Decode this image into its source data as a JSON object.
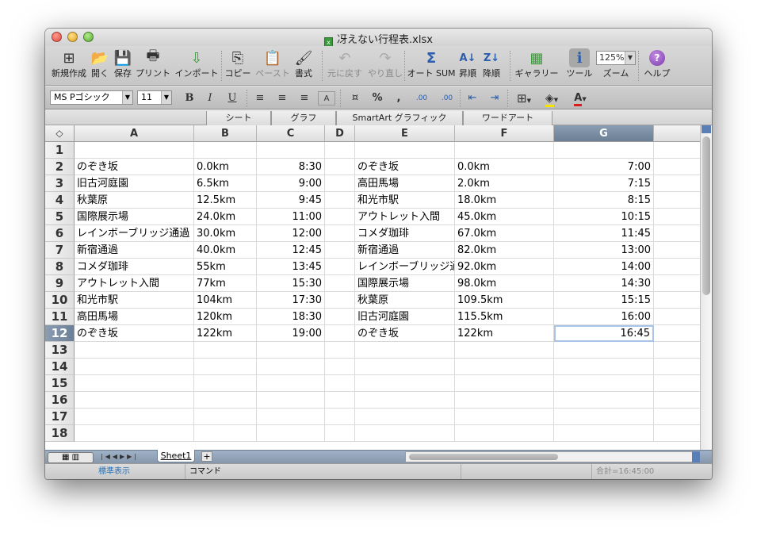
{
  "window": {
    "title": "冴えない行程表.xlsx"
  },
  "toolbar": {
    "items": [
      {
        "label": "新規作成",
        "icon": "new-workbook-icon",
        "glyph": "⊞",
        "enabled": true
      },
      {
        "label": "開く",
        "icon": "open-icon",
        "glyph": "📂",
        "enabled": true
      },
      {
        "label": "保存",
        "icon": "save-icon",
        "glyph": "💾",
        "enabled": true
      },
      {
        "label": "プリント",
        "icon": "print-icon",
        "glyph": "🖶",
        "enabled": true
      },
      {
        "label": "インポート",
        "icon": "import-icon",
        "glyph": "⇩",
        "enabled": true
      },
      {
        "label": "コピー",
        "icon": "copy-icon",
        "glyph": "⎘",
        "enabled": true
      },
      {
        "label": "ペースト",
        "icon": "paste-icon",
        "glyph": "📋",
        "enabled": false
      },
      {
        "label": "書式",
        "icon": "format-painter-icon",
        "glyph": "🖌",
        "enabled": true
      },
      {
        "label": "元に戻す",
        "icon": "undo-icon",
        "glyph": "↶",
        "enabled": false
      },
      {
        "label": "やり直し",
        "icon": "redo-icon",
        "glyph": "↷",
        "enabled": false
      },
      {
        "label": "オート SUM",
        "icon": "autosum-icon",
        "glyph": "Σ",
        "enabled": true
      },
      {
        "label": "昇順",
        "icon": "sort-ascending-icon",
        "glyph": "A↓",
        "enabled": true
      },
      {
        "label": "降順",
        "icon": "sort-descending-icon",
        "glyph": "Z↓",
        "enabled": true
      },
      {
        "label": "ギャラリー",
        "icon": "gallery-icon",
        "glyph": "▦",
        "enabled": true
      },
      {
        "label": "ツール",
        "icon": "toolbox-icon",
        "glyph": "ℹ",
        "enabled": true
      },
      {
        "label": "ズーム",
        "icon": "zoom-icon",
        "glyph": "",
        "enabled": true
      },
      {
        "label": "ヘルプ",
        "icon": "help-icon",
        "glyph": "?",
        "enabled": true
      }
    ],
    "zoom_value": "125%"
  },
  "format": {
    "font_name": "MS Pゴシック",
    "font_size": "11",
    "bold": "B",
    "italic": "I",
    "underline": "U",
    "wrap": "A",
    "percent": "%",
    "comma": ",",
    "dec_inc": ".00",
    "dec_dec": ".00",
    "font_color": "A"
  },
  "ribbon": {
    "tabs": [
      "シート",
      "グラフ",
      "SmartArt グラフィック",
      "ワードアート"
    ]
  },
  "sheet": {
    "columns": [
      "A",
      "B",
      "C",
      "D",
      "E",
      "F",
      "G"
    ],
    "active_column": "G",
    "active_row": "12",
    "row_numbers": [
      "1",
      "2",
      "3",
      "4",
      "5",
      "6",
      "7",
      "8",
      "9",
      "10",
      "11",
      "12",
      "13",
      "14",
      "15",
      "16",
      "17",
      "18"
    ],
    "rows": [
      [
        "",
        "",
        "",
        "",
        "",
        "",
        ""
      ],
      [
        "のぞき坂",
        "0.0km",
        "8:30",
        "",
        "のぞき坂",
        "0.0km",
        "7:00"
      ],
      [
        "旧古河庭園",
        "6.5km",
        "9:00",
        "",
        "高田馬場",
        "2.0km",
        "7:15"
      ],
      [
        "秋葉原",
        "12.5km",
        "9:45",
        "",
        "和光市駅",
        "18.0km",
        "8:15"
      ],
      [
        "国際展示場",
        "24.0km",
        "11:00",
        "",
        "アウトレット入間",
        "45.0km",
        "10:15"
      ],
      [
        "レインボーブリッジ通過",
        "30.0km",
        "12:00",
        "",
        "コメダ珈琲",
        "67.0km",
        "11:45"
      ],
      [
        "新宿通過",
        "40.0km",
        "12:45",
        "",
        "新宿通過",
        "82.0km",
        "13:00"
      ],
      [
        "コメダ珈琲",
        "55km",
        "13:45",
        "",
        "レインボーブリッジ通過",
        "92.0km",
        "14:00"
      ],
      [
        "アウトレット入間",
        "77km",
        "15:30",
        "",
        "国際展示場",
        "98.0km",
        "14:30"
      ],
      [
        "和光市駅",
        "104km",
        "17:30",
        "",
        "秋葉原",
        "109.5km",
        "15:15"
      ],
      [
        "高田馬場",
        "120km",
        "18:30",
        "",
        "旧古河庭園",
        "115.5km",
        "16:00"
      ],
      [
        "のぞき坂",
        "122km",
        "19:00",
        "",
        "のぞき坂",
        "122km",
        "16:45"
      ],
      [
        "",
        "",
        "",
        "",
        "",
        "",
        ""
      ],
      [
        "",
        "",
        "",
        "",
        "",
        "",
        ""
      ],
      [
        "",
        "",
        "",
        "",
        "",
        "",
        ""
      ],
      [
        "",
        "",
        "",
        "",
        "",
        "",
        ""
      ],
      [
        "",
        "",
        "",
        "",
        "",
        "",
        ""
      ],
      [
        "",
        "",
        "",
        "",
        "",
        "",
        ""
      ]
    ]
  },
  "sheettabs": {
    "active": "Sheet1",
    "add": "+"
  },
  "status": {
    "view_mode": "標準表示",
    "mode": "コマンド",
    "sum": "合計=16:45:00"
  },
  "colors": {
    "accent": "#6b7f96",
    "selection": "#a8c4e8"
  }
}
